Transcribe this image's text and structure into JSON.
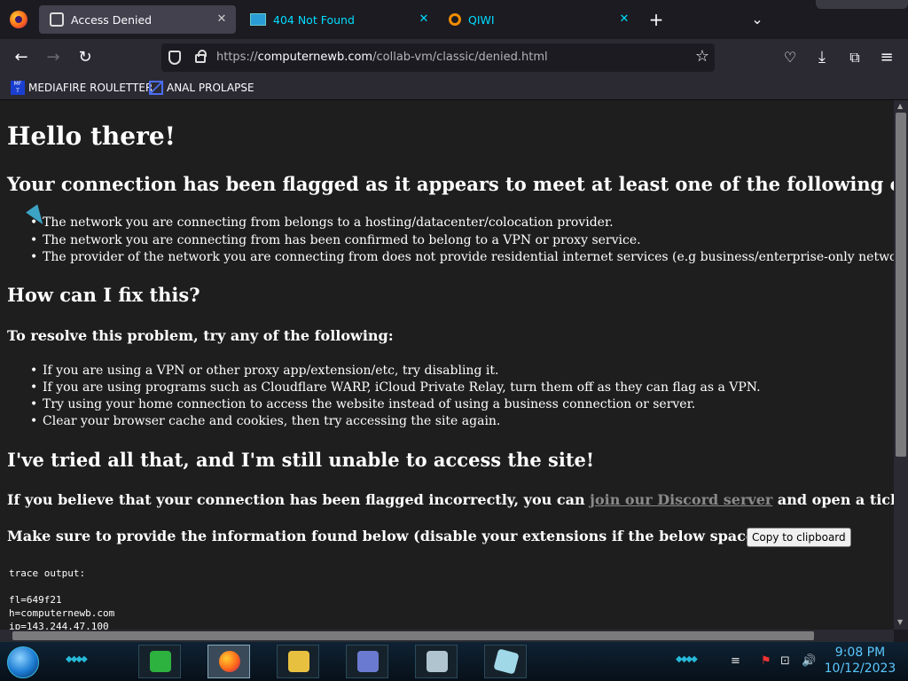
{
  "browser": {
    "tabs": [
      {
        "title": "Access Denied",
        "active": true
      },
      {
        "title": "404 Not Found",
        "active": false
      },
      {
        "title": "QIWI",
        "active": false
      }
    ],
    "url": {
      "scheme": "https://",
      "host": "computernewb.com",
      "path": "/collab-vm/classic/denied.html"
    },
    "bookmarks": [
      "MEDIAFIRE ROULETTER",
      "ANAL PROLAPSE"
    ]
  },
  "page": {
    "heading": "Hello there!",
    "flagged_heading": "Your connection has been flagged as it appears to meet at least one of the following criteria:",
    "criteria": [
      "The network you are connecting from belongs to a hosting/datacenter/colocation provider.",
      "The network you are connecting from has been confirmed to belong to a VPN or proxy service.",
      "The provider of the network you are connecting from does not provide residential internet services (e.g business/enterprise-only networks)."
    ],
    "fix_heading": "How can I fix this?",
    "resolve_heading": "To resolve this problem, try any of the following:",
    "fixes": [
      "If you are using a VPN or other proxy app/extension/etc, try disabling it.",
      "If you are using programs such as Cloudflare WARP, iCloud Private Relay, turn them off as they can flag as a VPN.",
      "Try using your home connection to access the website instead of using a business connection or server.",
      "Clear your browser cache and cookies, then try accessing the site again."
    ],
    "still_heading": "I've tried all that, and I'm still unable to access the site!",
    "discord_prefix": "If you believe that your connection has been flagged incorrectly, you can",
    "discord_link": "join our Discord server",
    "discord_suffix": "and open a ticket.",
    "provide_text": "Make sure to provide the information found below (disable your extensions if the below space is empty):",
    "copy_button": "Copy to clipboard",
    "trace_label": "trace output:",
    "trace_lines": [
      "fl=649f21",
      "h=computernewb.com",
      "ip=143.244.47.100"
    ]
  },
  "taskbar": {
    "time": "9:08 PM",
    "date": "10/12/2023"
  }
}
